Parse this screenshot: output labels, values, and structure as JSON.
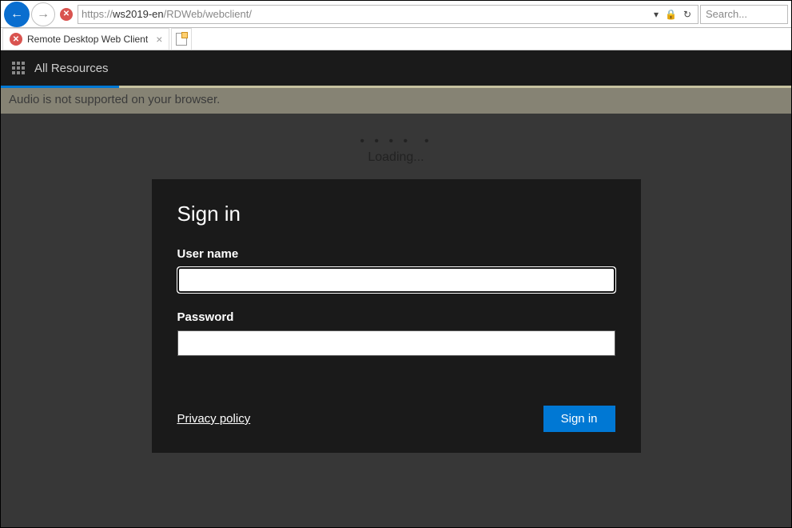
{
  "browser": {
    "url_protocol": "https://",
    "url_host": "ws2019-en",
    "url_path": "/RDWeb/webclient/",
    "search_placeholder": "Search..."
  },
  "tabs": {
    "active_title": "Remote Desktop Web Client"
  },
  "app": {
    "header_label": "All Resources",
    "audio_warning": "Audio is not supported on your browser.",
    "loading_text": "Loading..."
  },
  "signin": {
    "title": "Sign in",
    "username_label": "User name",
    "username_value": "",
    "password_label": "Password",
    "password_value": "",
    "privacy_label": "Privacy policy",
    "submit_label": "Sign in"
  }
}
